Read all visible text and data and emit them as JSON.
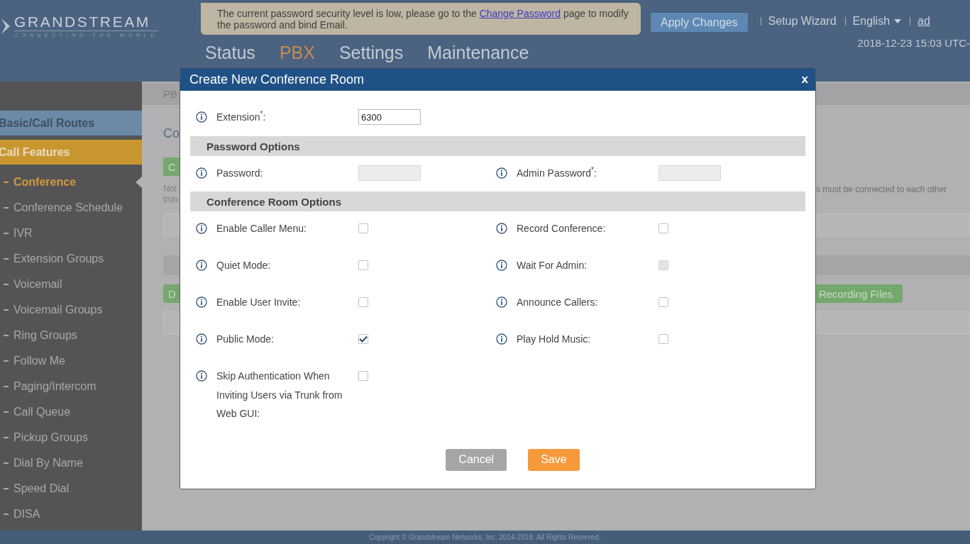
{
  "header": {
    "logo": {
      "name": "GRANDSTREAM",
      "tagline": "CONNECTING THE WORLD"
    },
    "notice": {
      "before": "The current password security level is low, please go to the ",
      "link": "Change Password",
      "after": " page to modify the password and bind Email."
    },
    "apply_button": "Apply Changes",
    "top_links": [
      {
        "label": "Setup Wizard",
        "kind": "link"
      },
      {
        "label": "English",
        "kind": "dropdown"
      },
      {
        "label": "ad",
        "kind": "link"
      }
    ],
    "datetime": "2018-12-23 15:03 UTC-",
    "nav_tabs": [
      {
        "label": "Status",
        "selected": false
      },
      {
        "label": "PBX",
        "selected": true
      },
      {
        "label": "Settings",
        "selected": false
      },
      {
        "label": "Maintenance",
        "selected": false
      }
    ]
  },
  "sidebar": {
    "groups": [
      {
        "label": "Basic/Call Routes",
        "selected": false
      },
      {
        "label": "Call Features",
        "selected": true,
        "children": [
          {
            "label": "Conference",
            "selected": true
          },
          {
            "label": "Conference Schedule",
            "selected": false
          },
          {
            "label": "IVR",
            "selected": false
          },
          {
            "label": "Extension Groups",
            "selected": false
          },
          {
            "label": "Voicemail",
            "selected": false
          },
          {
            "label": "Voicemail Groups",
            "selected": false
          },
          {
            "label": "Ring Groups",
            "selected": false
          },
          {
            "label": "Follow Me",
            "selected": false
          },
          {
            "label": "Paging/Intercom",
            "selected": false
          },
          {
            "label": "Call Queue",
            "selected": false
          },
          {
            "label": "Pickup Groups",
            "selected": false
          },
          {
            "label": "Dial By Name",
            "selected": false
          },
          {
            "label": "Speed Dial",
            "selected": false
          },
          {
            "label": "DISA",
            "selected": false
          }
        ]
      }
    ]
  },
  "background_page": {
    "breadcrumb": "PB",
    "heading": "Co",
    "buttons": [
      "C",
      "D"
    ],
    "note_left": [
      "Not",
      "trun"
    ],
    "note_right": "s must be connected to each other",
    "right_button": "Recording Files"
  },
  "modal": {
    "title": "Create New Conference Room",
    "close": "x",
    "extension": {
      "label": "Extension$^{*}$:",
      "value": "6300"
    },
    "sections": [
      {
        "title": "Password Options",
        "fields": [
          {
            "kind": "text",
            "label": "Password:",
            "disabled": true
          },
          {
            "kind": "text",
            "label": "Admin Password$^{*}$:",
            "disabled": true
          }
        ]
      },
      {
        "title": "Conference Room Options",
        "fields": [
          {
            "kind": "checkbox",
            "label": "Enable Caller Menu:",
            "checked": false,
            "disabled": false
          },
          {
            "kind": "checkbox",
            "label": "Record Conference:",
            "checked": false,
            "disabled": false
          },
          {
            "kind": "checkbox",
            "label": "Quiet Mode:",
            "checked": false,
            "disabled": false
          },
          {
            "kind": "checkbox",
            "label": "Wait For Admin:",
            "checked": false,
            "disabled": true
          },
          {
            "kind": "checkbox",
            "label": "Enable User Invite:",
            "checked": false,
            "disabled": false
          },
          {
            "kind": "checkbox",
            "label": "Announce Callers:",
            "checked": false,
            "disabled": false
          },
          {
            "kind": "checkbox",
            "label": "Public Mode:",
            "checked": true,
            "disabled": false
          },
          {
            "kind": "checkbox",
            "label": "Play Hold Music:",
            "checked": false,
            "disabled": false
          },
          {
            "kind": "checkbox",
            "label": "Skip Authentication When Inviting Users via Trunk from Web GUI:",
            "checked": false,
            "disabled": false
          }
        ]
      }
    ],
    "buttons": [
      {
        "label": "Cancel",
        "kind": "secondary"
      },
      {
        "label": "Save",
        "kind": "primary"
      }
    ]
  },
  "footer": "Copyright © Grandstream Networks, Inc. 2014-2018. All Rights Reserved."
}
